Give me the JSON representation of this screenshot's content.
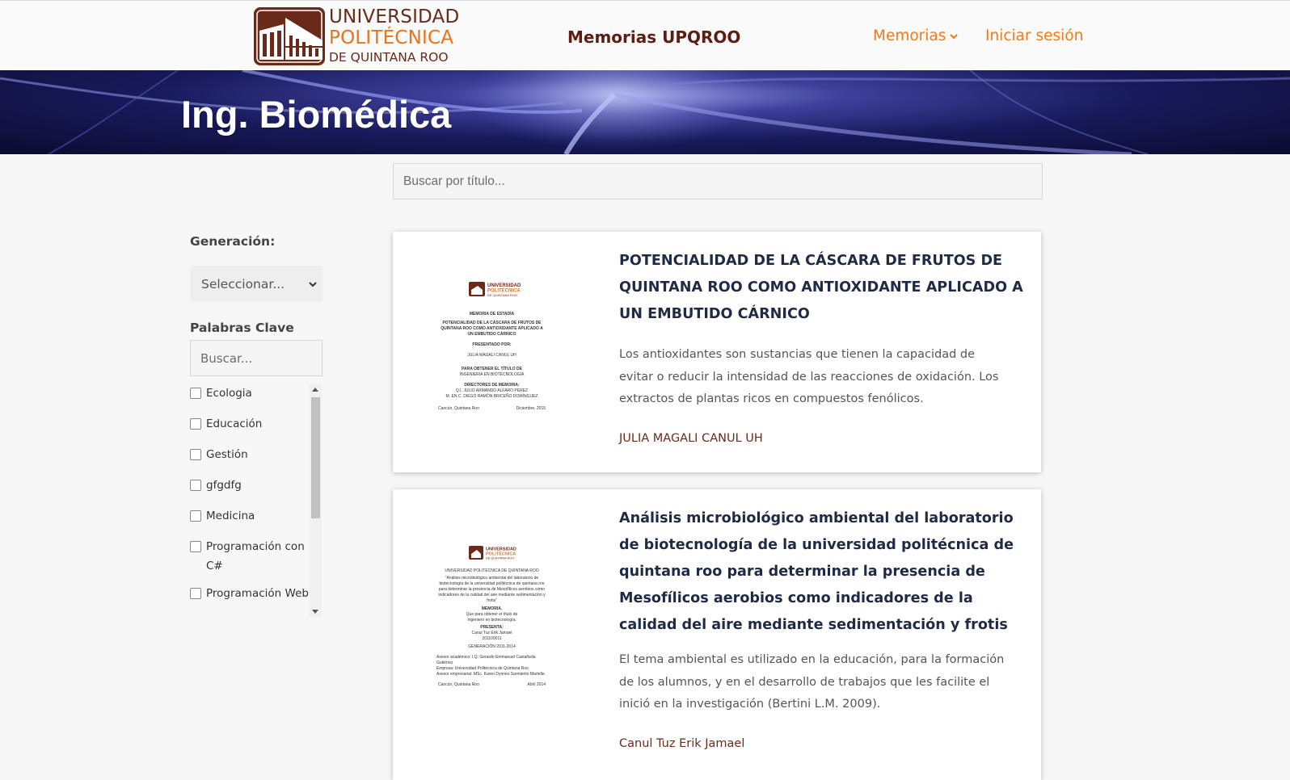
{
  "header": {
    "logo": {
      "line1": "UNIVERSIDAD",
      "line2": "POLITÉCNICA",
      "line3": "DE QUINTANA ROO"
    },
    "site_title": "Memorias UPQROO",
    "nav": {
      "memorias": "Memorias",
      "login": "Iniciar sesión"
    },
    "colors": {
      "brand_dark": "#6a2a1a",
      "brand_orange": "#e8731c",
      "nav_orange": "#f07a1a"
    }
  },
  "banner": {
    "title": "Ing. Biomédica"
  },
  "search": {
    "placeholder": "Buscar por título..."
  },
  "sidebar": {
    "generation_label": "Generación:",
    "generation_select": "Seleccionar...",
    "keywords_label": "Palabras Clave",
    "keywords_placeholder": "Buscar...",
    "keywords": [
      "Ecologia",
      "Educación",
      "Gestión",
      "gfgdfg",
      "Medicina",
      "Programación con C#",
      "Programación Web"
    ]
  },
  "cards": [
    {
      "title": "POTENCIALIDAD DE LA CÁSCARA DE FRUTOS DE QUINTANA ROO COMO ANTIOXIDANTE APLICADO A UN EMBUTIDO CÁRNICO",
      "description": "Los antioxidantes son sustancias que tienen la capacidad de evitar o reducir la intensidad de las reacciones de oxidación. Los extractos de plantas ricos en compuestos fenólicos.",
      "author": "JULIA MAGALI CANUL UH",
      "thumbnail": {
        "header": "MEMORIA DE ESTADÍA",
        "title": "POTENCIALIDAD DE LA CÁSCARA DE FRUTOS DE QUINTANA ROO COMO ANTIOXIDANTE APLICADO A UN EMBUTIDO CÁRNICO",
        "presented_by": "PRESENTADO POR:",
        "student": "JULIA MAGALI CANUL UH",
        "degree_label": "PARA OBTENER EL TÍTULO DE",
        "degree": "INGENIERÍA EN BIOTECNOLOGÍA",
        "directors_label": "DIRECTORES DE MEMORIA:",
        "director1": "Q.I. JULIO ARMANDO ALFARO PÉREZ",
        "director2": "M. EN C. DIEGO RAMÓN BRICEÑO DOMÍNGUEZ",
        "place": "Cancún, Quintana Roo",
        "date": "Diciembre, 2015"
      }
    },
    {
      "title": "Análisis microbiológico ambiental del laboratorio de biotecnología de la universidad politécnica de quintana roo para determinar la presencia de Mesofílicos aerobios como indicadores de la calidad del aire mediante sedimentación y frotis",
      "description": "El tema ambiental es utilizado en la educación, para la formación de los alumnos, y en el desarrollo de trabajos que les facilite el inició en la investigación (Bertini L.M. 2009).",
      "author": "Canul Tuz Erik Jamael",
      "thumbnail": {
        "university": "UNIVERSIDAD POLITÉCNICA DE QUINTANA ROO",
        "title": "“Análisis microbiológico ambiental del laboratorio de biotecnología de la universidad politécnica de quintana roo para determinar la presencia de Mesofílicos aerobios como indicadores de la calidad del aire mediante sedimentación y frotis”",
        "doc_type": "MEMORIA.",
        "degree_label": "Que para obtener el título de",
        "degree": "Ingeniero en biotecnología.",
        "presents": "PRESENTA:",
        "student": "Canul Tuz Erik Jamael",
        "student_id": "201100011",
        "generation": "GENERACIÓN 2011-2014",
        "advisor1": "Asesor académico: I.Q. Gerardo Emmanuel Castañeda Gutiérrez",
        "company": "Empresa: Universidad Politécnica de Quintana Roo",
        "advisor2": "Asesor empresarial: MSc. Karen Dynnes Sarmiento Martelle.",
        "place": "Cancún, Quintana Roo",
        "date": "Abril 2014"
      }
    }
  ]
}
